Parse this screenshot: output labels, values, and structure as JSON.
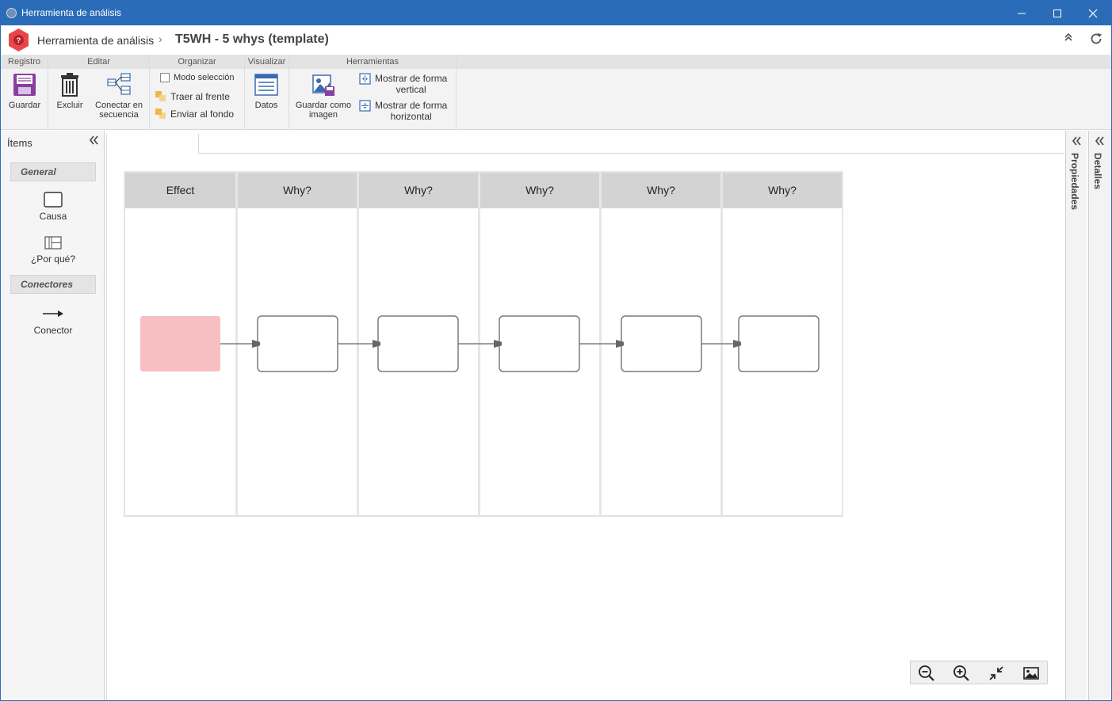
{
  "window": {
    "title": "Herramienta de análisis"
  },
  "header": {
    "app_name": "Herramienta de análisis",
    "separator": "›",
    "document_title": "T5WH - 5 whys (template)"
  },
  "ribbon": {
    "groups": {
      "registro": "Registro",
      "editar": "Editar",
      "organizar": "Organizar",
      "visualizar": "Visualizar",
      "herramientas": "Herramientas"
    },
    "guardar": "Guardar",
    "excluir": "Excluir",
    "conectar_line1": "Conectar en",
    "conectar_line2": "secuencia",
    "modo_seleccion": "Modo selección",
    "traer_frente": "Traer al frente",
    "enviar_fondo": "Enviar al fondo",
    "datos": "Datos",
    "guardar_imagen_line1": "Guardar como",
    "guardar_imagen_line2": "imagen",
    "vertical_line1": "Mostrar de forma",
    "vertical_line2": "vertical",
    "horizontal_line1": "Mostrar de forma",
    "horizontal_line2": "horizontal"
  },
  "left_panel": {
    "title": "Ítems",
    "collapse_icon": "double-chevron-left-icon",
    "general_section": "General",
    "causa": "Causa",
    "por_que": "¿Por qué?",
    "conectores_section": "Conectores",
    "conector": "Conector"
  },
  "diagram": {
    "columns": [
      "Effect",
      "Why?",
      "Why?",
      "Why?",
      "Why?",
      "Why?"
    ],
    "effect_color": "#f8bfc2",
    "header_color": "#d3d3d3"
  },
  "side_tabs": {
    "propiedades": "Propiedades",
    "detalles": "Detalles"
  },
  "colors": {
    "titlebar": "#2b6cb8",
    "logo": "#e8474a",
    "guardar_icon": "#8a3fa0",
    "accent_blue": "#3a6bb0"
  }
}
